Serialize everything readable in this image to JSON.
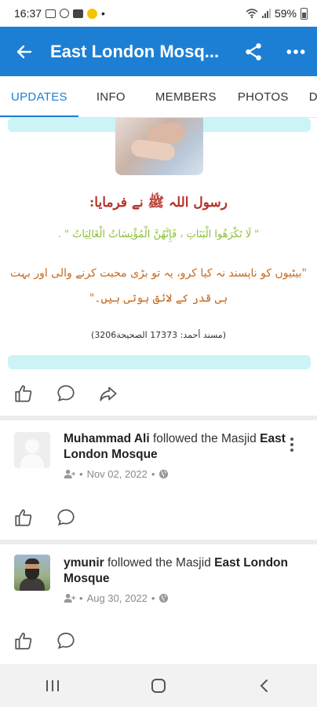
{
  "status_bar": {
    "time": "16:37",
    "dot": "•",
    "battery": "59%",
    "icons": [
      "sim-icon",
      "circle-icon",
      "tv-icon",
      "emoji-icon",
      "wifi-icon",
      "signal-icon",
      "battery-icon"
    ]
  },
  "app_bar": {
    "title": "East London Mosq...",
    "back_icon": "arrow-left-icon",
    "share_icon": "share-icon",
    "more_icon": "more-vert-icon",
    "color": "#1c7fd4"
  },
  "tabs": [
    {
      "label": "UPDATES",
      "active": true
    },
    {
      "label": "INFO",
      "active": false
    },
    {
      "label": "MEMBERS",
      "active": false
    },
    {
      "label": "PHOTOS",
      "active": false
    },
    {
      "label": "DIS",
      "active": false
    }
  ],
  "post": {
    "urdu_heading": "رسول اللہ ﷺ نے فرمایا:",
    "urdu_arabic": "\" لَا تَكْرَهُوا الْبَنَاتِ ، فَإِنَّهُنَّ الْمُؤْنِسَاتُ الْغَالِيَاتُ \" .",
    "urdu_line1": "\"بیٹیوں کو ناپسند نہ کیا کرو، یہ تو بڑی محبت کرنے والی اور بہت",
    "urdu_line2": "ہی قدر کے لائق ہوتی ہیں۔\"",
    "reference": "(مسند أحمد: 17373 الصحيحة3206)",
    "band_color": "#ccf3f6"
  },
  "feed": [
    {
      "user": "Muhammad Ali",
      "action": "followed the Masjid",
      "target": "East London Mosque",
      "date": "Nov 02, 2022",
      "separator": "•"
    },
    {
      "user": "ymunir",
      "action": "followed the Masjid",
      "target": "East London Mosque",
      "date": "Aug 30, 2022",
      "separator": "•"
    }
  ],
  "nav_bar": {
    "icons": [
      "recent-apps-icon",
      "home-icon",
      "back-icon"
    ]
  }
}
